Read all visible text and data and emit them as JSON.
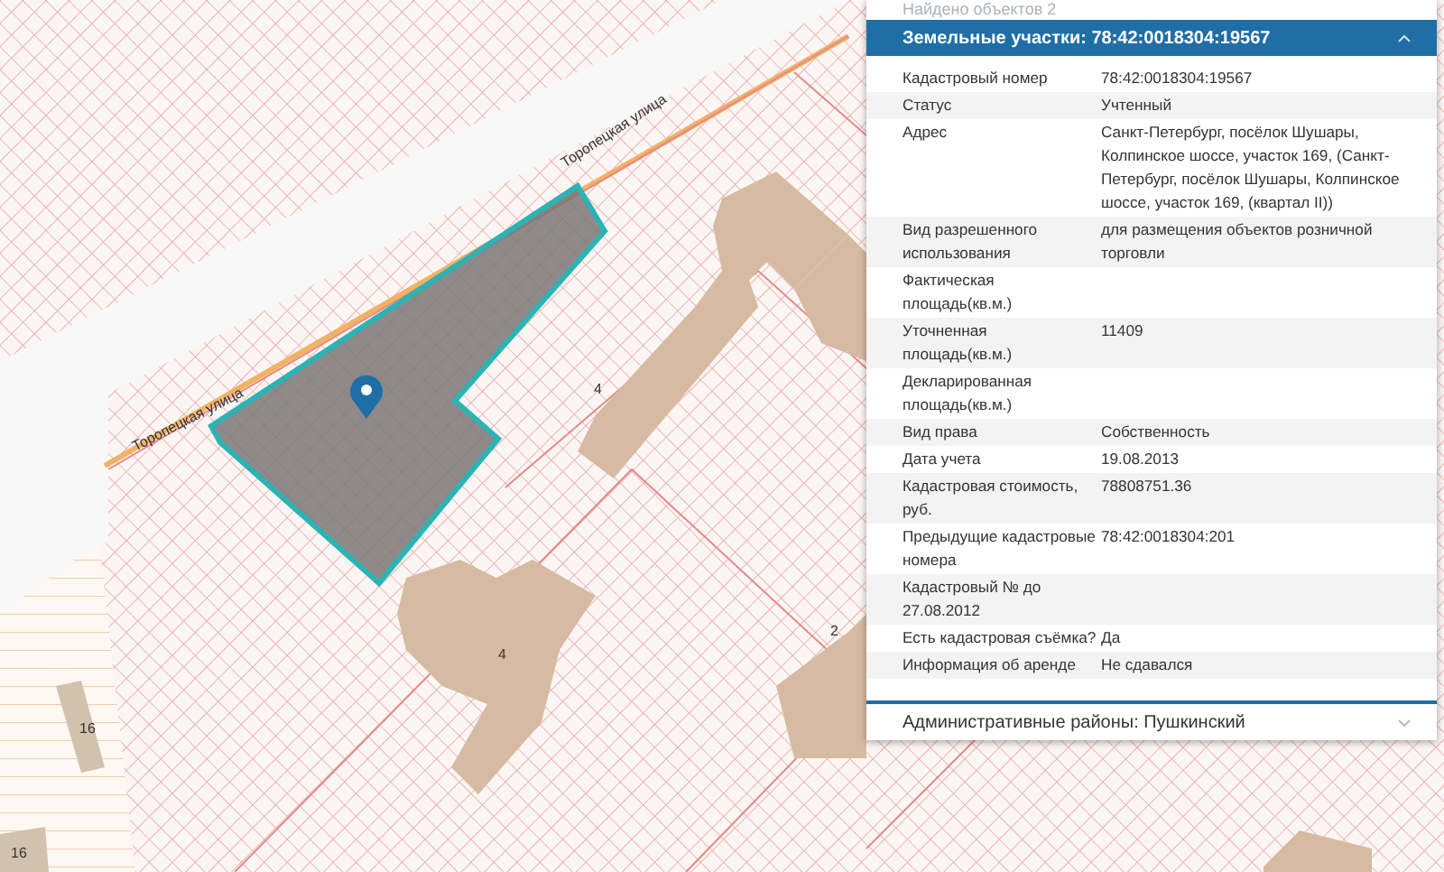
{
  "map": {
    "street_labels": [
      "Торопецкая улица",
      "Торопецкая улица"
    ],
    "building_numbers": [
      "4",
      "4",
      "2",
      "16",
      "16"
    ]
  },
  "panel": {
    "found_count": "Найдено объектов 2",
    "sections": [
      {
        "title": "Земельные участки: 78:42:0018304:19567",
        "expanded": true,
        "rows": [
          {
            "label": "Кадастровый номер",
            "value": "78:42:0018304:19567"
          },
          {
            "label": "Статус",
            "value": "Учтенный"
          },
          {
            "label": "Адрес",
            "value": "Санкт-Петербург, посёлок Шушары, Колпинское шоссе, участок 169, (Санкт-Петербург, посёлок Шушары, Колпинское шоссе, участок 169, (квартал II))"
          },
          {
            "label": "Вид разрешенного использования",
            "value": "для размещения объектов розничной торговли"
          },
          {
            "label": "Фактическая площадь(кв.м.)"
          },
          {
            "label": "Уточненная площадь(кв.м.)",
            "value": "11409"
          },
          {
            "label": "Декларированная площадь(кв.м.)"
          },
          {
            "label": "Вид права",
            "value": "Собственность"
          },
          {
            "label": "Дата учета",
            "value": "19.08.2013"
          },
          {
            "label": "Кадастровая стоимость, руб.",
            "value": "78808751.36"
          },
          {
            "label": "Предыдущие кадастровые номера",
            "value": "78:42:0018304:201"
          },
          {
            "label": "Кадастровый № до 27.08.2012"
          },
          {
            "label": "Есть кадастровая съёмка?",
            "value": "Да"
          },
          {
            "label": "Информация об аренде",
            "value": "Не сдавался"
          }
        ]
      },
      {
        "title": "Административные районы: Пушкинский",
        "expanded": false
      }
    ]
  }
}
